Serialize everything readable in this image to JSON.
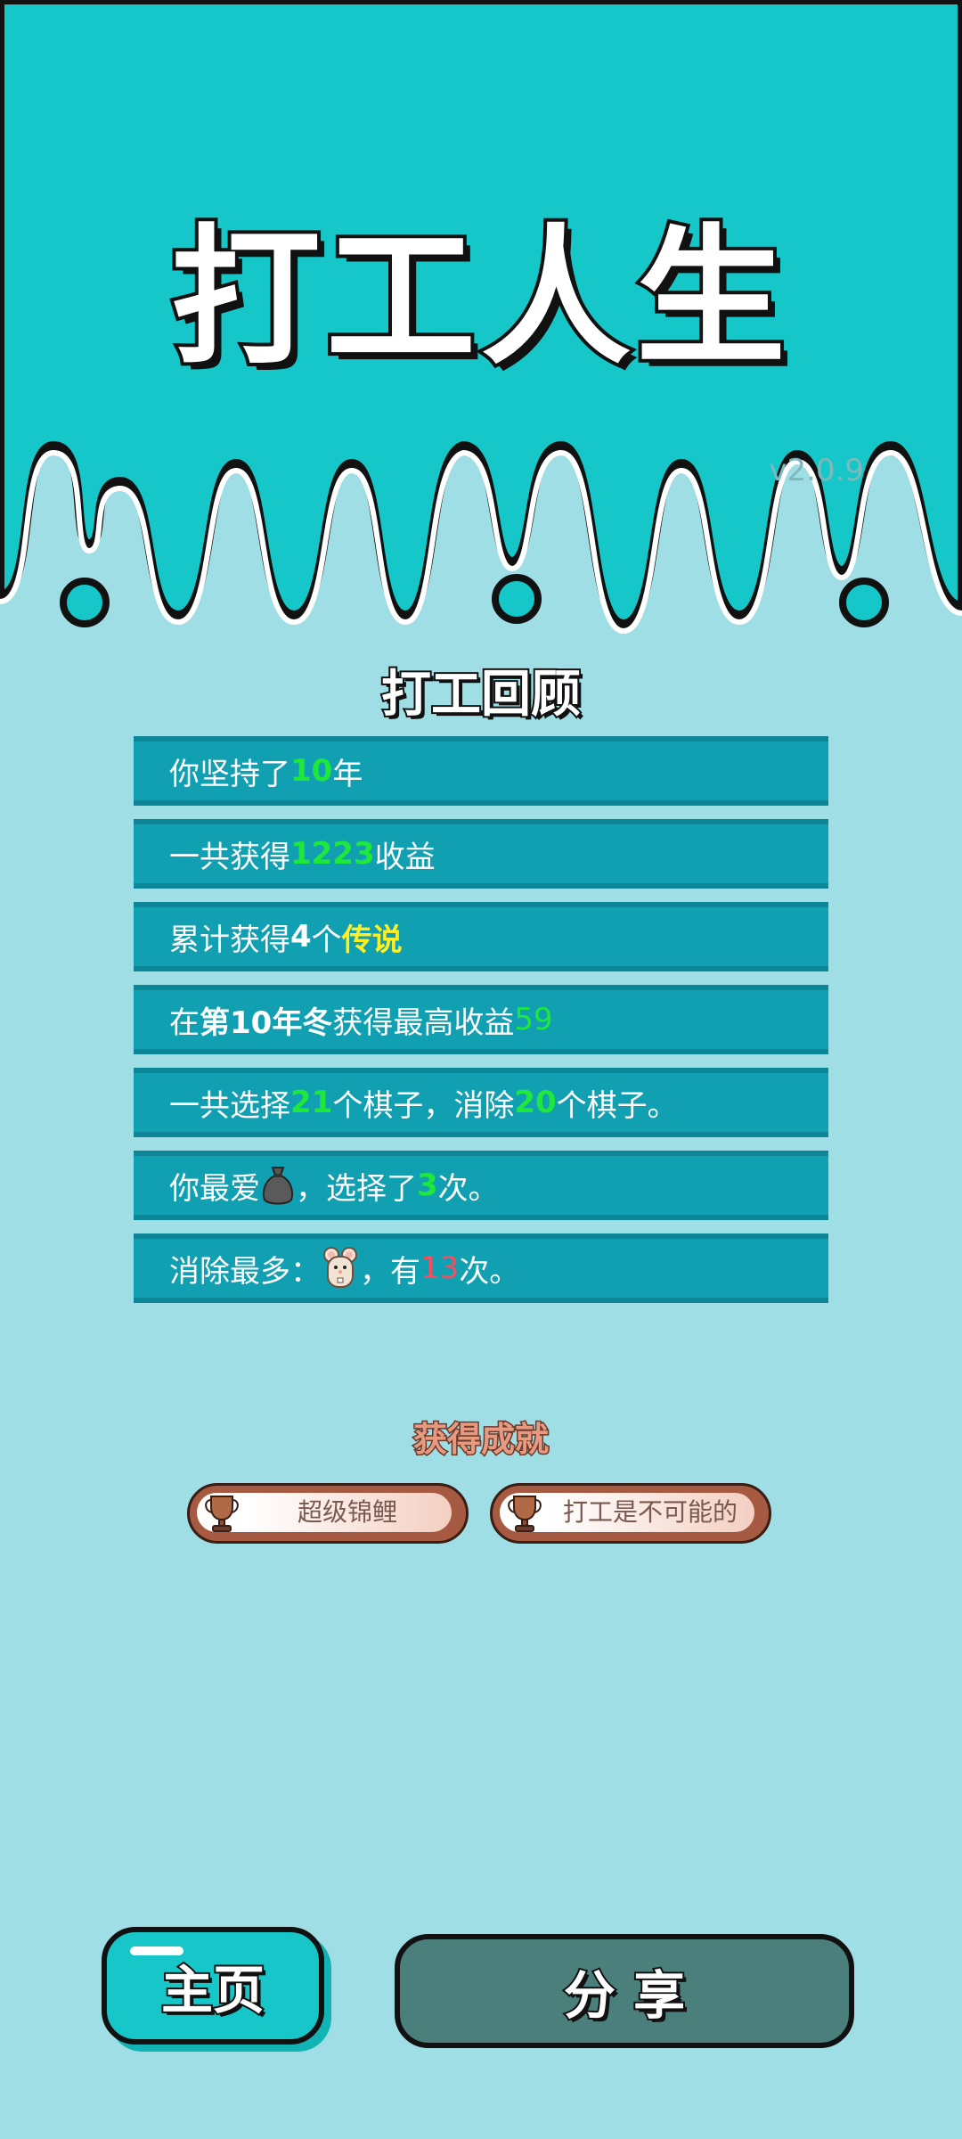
{
  "app": {
    "title": "打工人生",
    "version": "v2.0.9"
  },
  "review": {
    "title": "打工回顾",
    "rows": [
      {
        "prefix": "你坚持了",
        "value": "10",
        "suffix": "年"
      },
      {
        "prefix": "一共获得",
        "value": "1223",
        "suffix": "收益"
      },
      {
        "prefix": "累计获得",
        "value": "4",
        "mid": "个",
        "highlight": "传说"
      },
      {
        "prefix": "在 ",
        "bold": "第10年冬",
        "mid": " 获得最高收益",
        "value": "59"
      },
      {
        "prefix": "一共选择",
        "value": "21",
        "mid": "个棋子，消除",
        "value2": "20",
        "suffix": "个棋子。"
      },
      {
        "prefix": "你最爱",
        "icon": "money-bag-icon",
        "mid": "，选择了",
        "value": "3",
        "suffix": "次。"
      },
      {
        "prefix": "消除最多：",
        "icon": "mouse-icon",
        "mid": "，有",
        "value": "13",
        "suffix": "次。"
      }
    ]
  },
  "achievements": {
    "title": "获得成就",
    "items": [
      {
        "label": "超级锦鲤",
        "icon": "trophy-icon"
      },
      {
        "label": "打工是不可能的",
        "icon": "trophy-icon"
      }
    ]
  },
  "buttons": {
    "home": "主页",
    "share": "分 享"
  },
  "colors": {
    "top_bg": "#16c7c9",
    "bottom_bg": "#a0dee6",
    "row_bg": "#119fb2",
    "green": "#1ee83c",
    "yellow": "#ffee22",
    "red": "#ff4a5a"
  }
}
